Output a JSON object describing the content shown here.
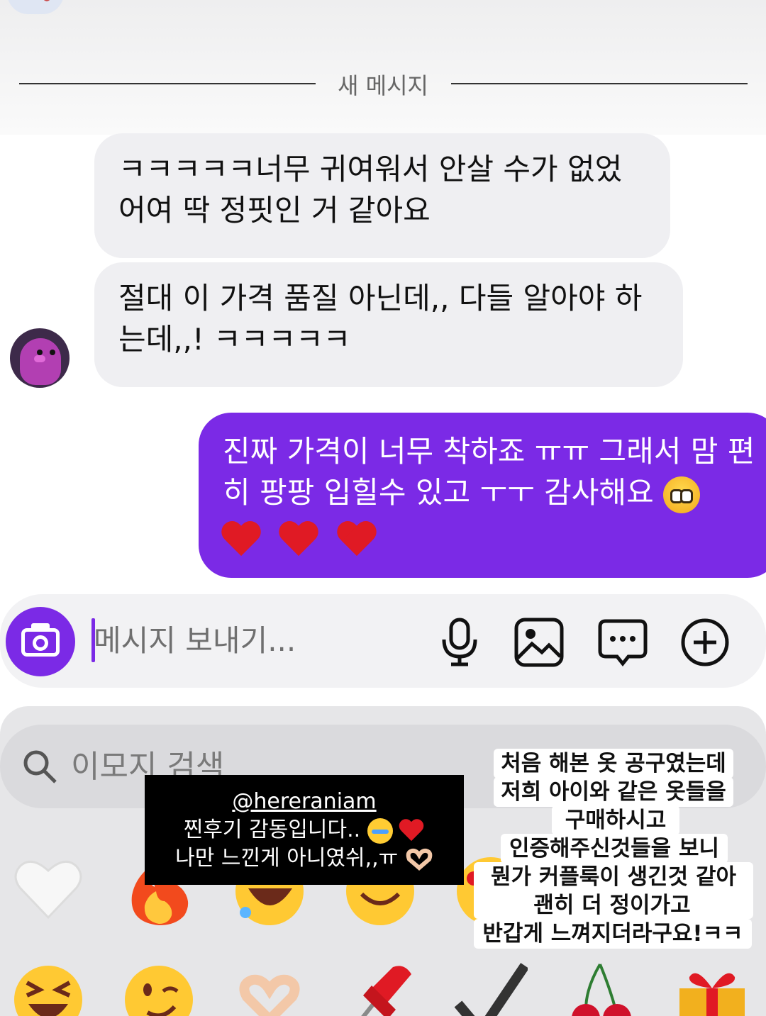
{
  "divider": {
    "label": "새 메시지"
  },
  "messages": {
    "incoming_1": "ㅋㅋㅋㅋㅋ너무 귀여워서 안살 수가 없었어여 딱 정핏인 거 같아요",
    "incoming_2": "절대 이 가격 품질 아닌데,, 다들 알아야 하는데,,! ㅋㅋㅋㅋㅋ",
    "outgoing_1": "진짜 가격이 너무 착하죠 ㅠㅠ 그래서 맘 편히 팡팡 입힐수 있고 ㅜㅜ 감사해요"
  },
  "composer": {
    "placeholder": "메시지 보내기..."
  },
  "emoji_panel": {
    "search_placeholder": "이모지 검색",
    "row1": [
      "white-heart-icon",
      "fire-icon",
      "rofl-face-icon",
      "smiling-face-icon",
      "heart-eyes-face-icon"
    ],
    "row2": [
      "squinting-face-icon",
      "winking-face-icon",
      "heart-hands-icon",
      "pushpin-icon",
      "check-mark-icon",
      "cherries-icon",
      "gift-icon"
    ]
  },
  "overlay": {
    "handle": "@hereraniam",
    "line1": "찐후기 감동입니다..",
    "line2": "나만 느낀게 아니였쉬,,ㅠ",
    "white_lines": [
      "처음 해본 옷 공구였는데",
      "저희 아이와 같은 옷들을",
      "구매하시고",
      "인증해주신것들을 보니",
      "뭔가 커플룩이 생긴것 같아서",
      "괜히 더 정이가고",
      "반갑게 느껴지더라구요!ㅋㅋ"
    ]
  },
  "colors": {
    "accent": "#7b2ae6",
    "incoming_bubble": "#efeff2",
    "heart": "#e01a24"
  }
}
